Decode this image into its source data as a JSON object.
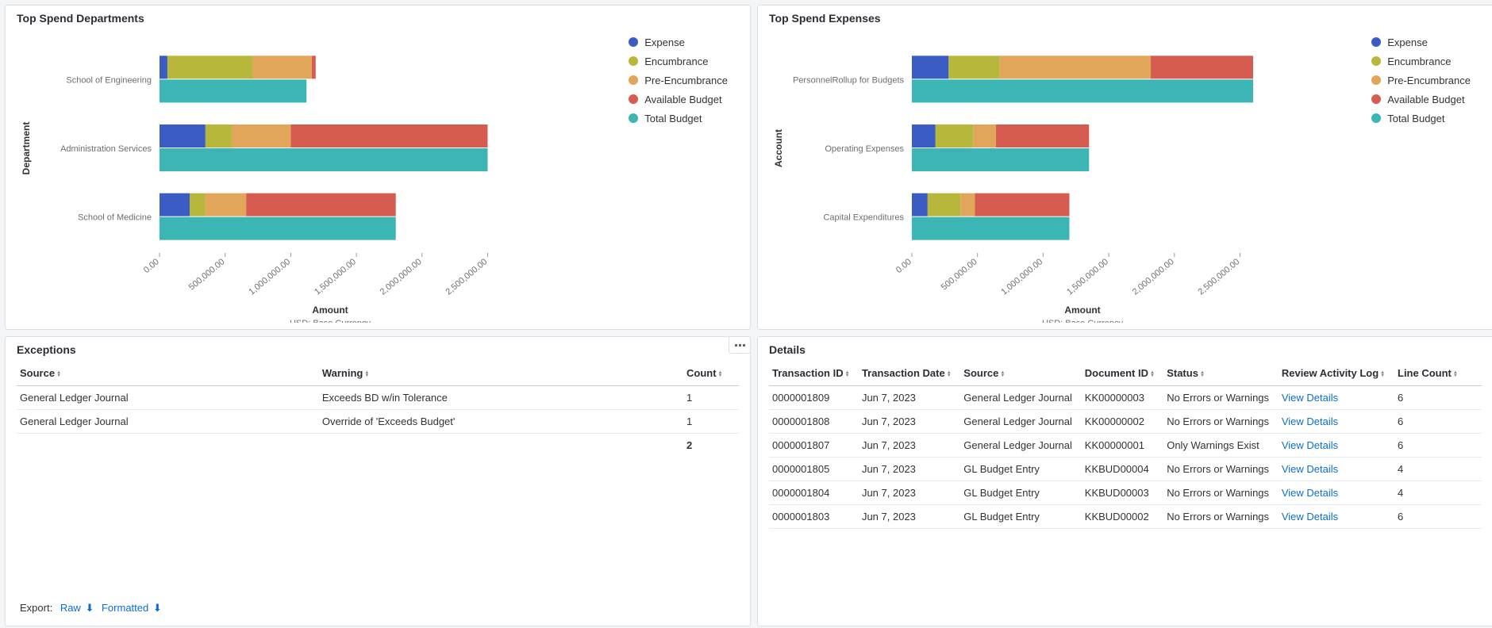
{
  "colors": {
    "expense": "#3b5cc4",
    "encumbrance": "#b7b83b",
    "preEncumbrance": "#e1a65a",
    "availableBudget": "#d55c4f",
    "totalBudget": "#3cb5b5"
  },
  "legend": [
    "Expense",
    "Encumbrance",
    "Pre-Encumbrance",
    "Available Budget",
    "Total Budget"
  ],
  "chart_data": [
    {
      "id": "top-spend-departments",
      "type": "bar",
      "orientation": "horizontal",
      "title": "Top Spend Departments",
      "ylabel": "Department",
      "xlabel": "Amount",
      "xsubtitle": "USD: Base Currency",
      "xlim": [
        0,
        2600000
      ],
      "xticks": [
        0,
        500000,
        1000000,
        1500000,
        2000000,
        2500000
      ],
      "categories": [
        "School of Engineering",
        "Administration Services",
        "School of Medicine"
      ],
      "stacked_series": [
        {
          "name": "Expense",
          "color": "#3b5cc4",
          "values": [
            60000,
            350000,
            230000
          ]
        },
        {
          "name": "Encumbrance",
          "color": "#b7b83b",
          "values": [
            650000,
            200000,
            120000
          ]
        },
        {
          "name": "Pre-Encumbrance",
          "color": "#e1a65a",
          "values": [
            450000,
            450000,
            310000
          ]
        },
        {
          "name": "Available Budget",
          "color": "#d55c4f",
          "values": [
            30000,
            1500000,
            1140000
          ]
        }
      ],
      "total_series": {
        "name": "Total Budget",
        "color": "#3cb5b5",
        "values": [
          1120000,
          2500000,
          1800000
        ]
      }
    },
    {
      "id": "top-spend-expenses",
      "type": "bar",
      "orientation": "horizontal",
      "title": "Top Spend Expenses",
      "ylabel": "Account",
      "xlabel": "Amount",
      "xsubtitle": "USD: Base Currency",
      "xlim": [
        0,
        2600000
      ],
      "xticks": [
        0,
        500000,
        1000000,
        1500000,
        2000000,
        2500000
      ],
      "categories": [
        "PersonnelRollup for Budgets",
        "Operating Expenses",
        "Capital Expenditures"
      ],
      "stacked_series": [
        {
          "name": "Expense",
          "color": "#3b5cc4",
          "values": [
            280000,
            180000,
            120000
          ]
        },
        {
          "name": "Encumbrance",
          "color": "#b7b83b",
          "values": [
            390000,
            290000,
            250000
          ]
        },
        {
          "name": "Pre-Encumbrance",
          "color": "#e1a65a",
          "values": [
            1150000,
            170000,
            110000
          ]
        },
        {
          "name": "Available Budget",
          "color": "#d55c4f",
          "values": [
            780000,
            710000,
            720000
          ]
        }
      ],
      "total_series": {
        "name": "Total Budget",
        "color": "#3cb5b5",
        "values": [
          2600000,
          1350000,
          1200000
        ]
      }
    }
  ],
  "exceptions": {
    "title": "Exceptions",
    "columns": [
      "Source",
      "Warning",
      "Count"
    ],
    "rows": [
      {
        "source": "General Ledger Journal",
        "warning": "Exceeds BD w/in Tolerance",
        "count": 1
      },
      {
        "source": "General Ledger Journal",
        "warning": "Override of 'Exceeds Budget'",
        "count": 1
      }
    ],
    "total_count": 2,
    "export_label": "Export:",
    "export_raw": "Raw",
    "export_formatted": "Formatted"
  },
  "details": {
    "title": "Details",
    "columns": [
      "Transaction ID",
      "Transaction Date",
      "Source",
      "Document ID",
      "Status",
      "Review Activity Log",
      "Line Count"
    ],
    "view_details_label": "View Details",
    "rows": [
      {
        "tid": "0000001809",
        "date": "Jun 7, 2023",
        "source": "General Ledger Journal",
        "docid": "KK00000003",
        "status": "No Errors or Warnings",
        "lines": 6
      },
      {
        "tid": "0000001808",
        "date": "Jun 7, 2023",
        "source": "General Ledger Journal",
        "docid": "KK00000002",
        "status": "No Errors or Warnings",
        "lines": 6
      },
      {
        "tid": "0000001807",
        "date": "Jun 7, 2023",
        "source": "General Ledger Journal",
        "docid": "KK00000001",
        "status": "Only Warnings Exist",
        "lines": 6
      },
      {
        "tid": "0000001805",
        "date": "Jun 7, 2023",
        "source": "GL Budget Entry",
        "docid": "KKBUD00004",
        "status": "No Errors or Warnings",
        "lines": 4
      },
      {
        "tid": "0000001804",
        "date": "Jun 7, 2023",
        "source": "GL Budget Entry",
        "docid": "KKBUD00003",
        "status": "No Errors or Warnings",
        "lines": 4
      },
      {
        "tid": "0000001803",
        "date": "Jun 7, 2023",
        "source": "GL Budget Entry",
        "docid": "KKBUD00002",
        "status": "No Errors or Warnings",
        "lines": 6
      }
    ]
  }
}
